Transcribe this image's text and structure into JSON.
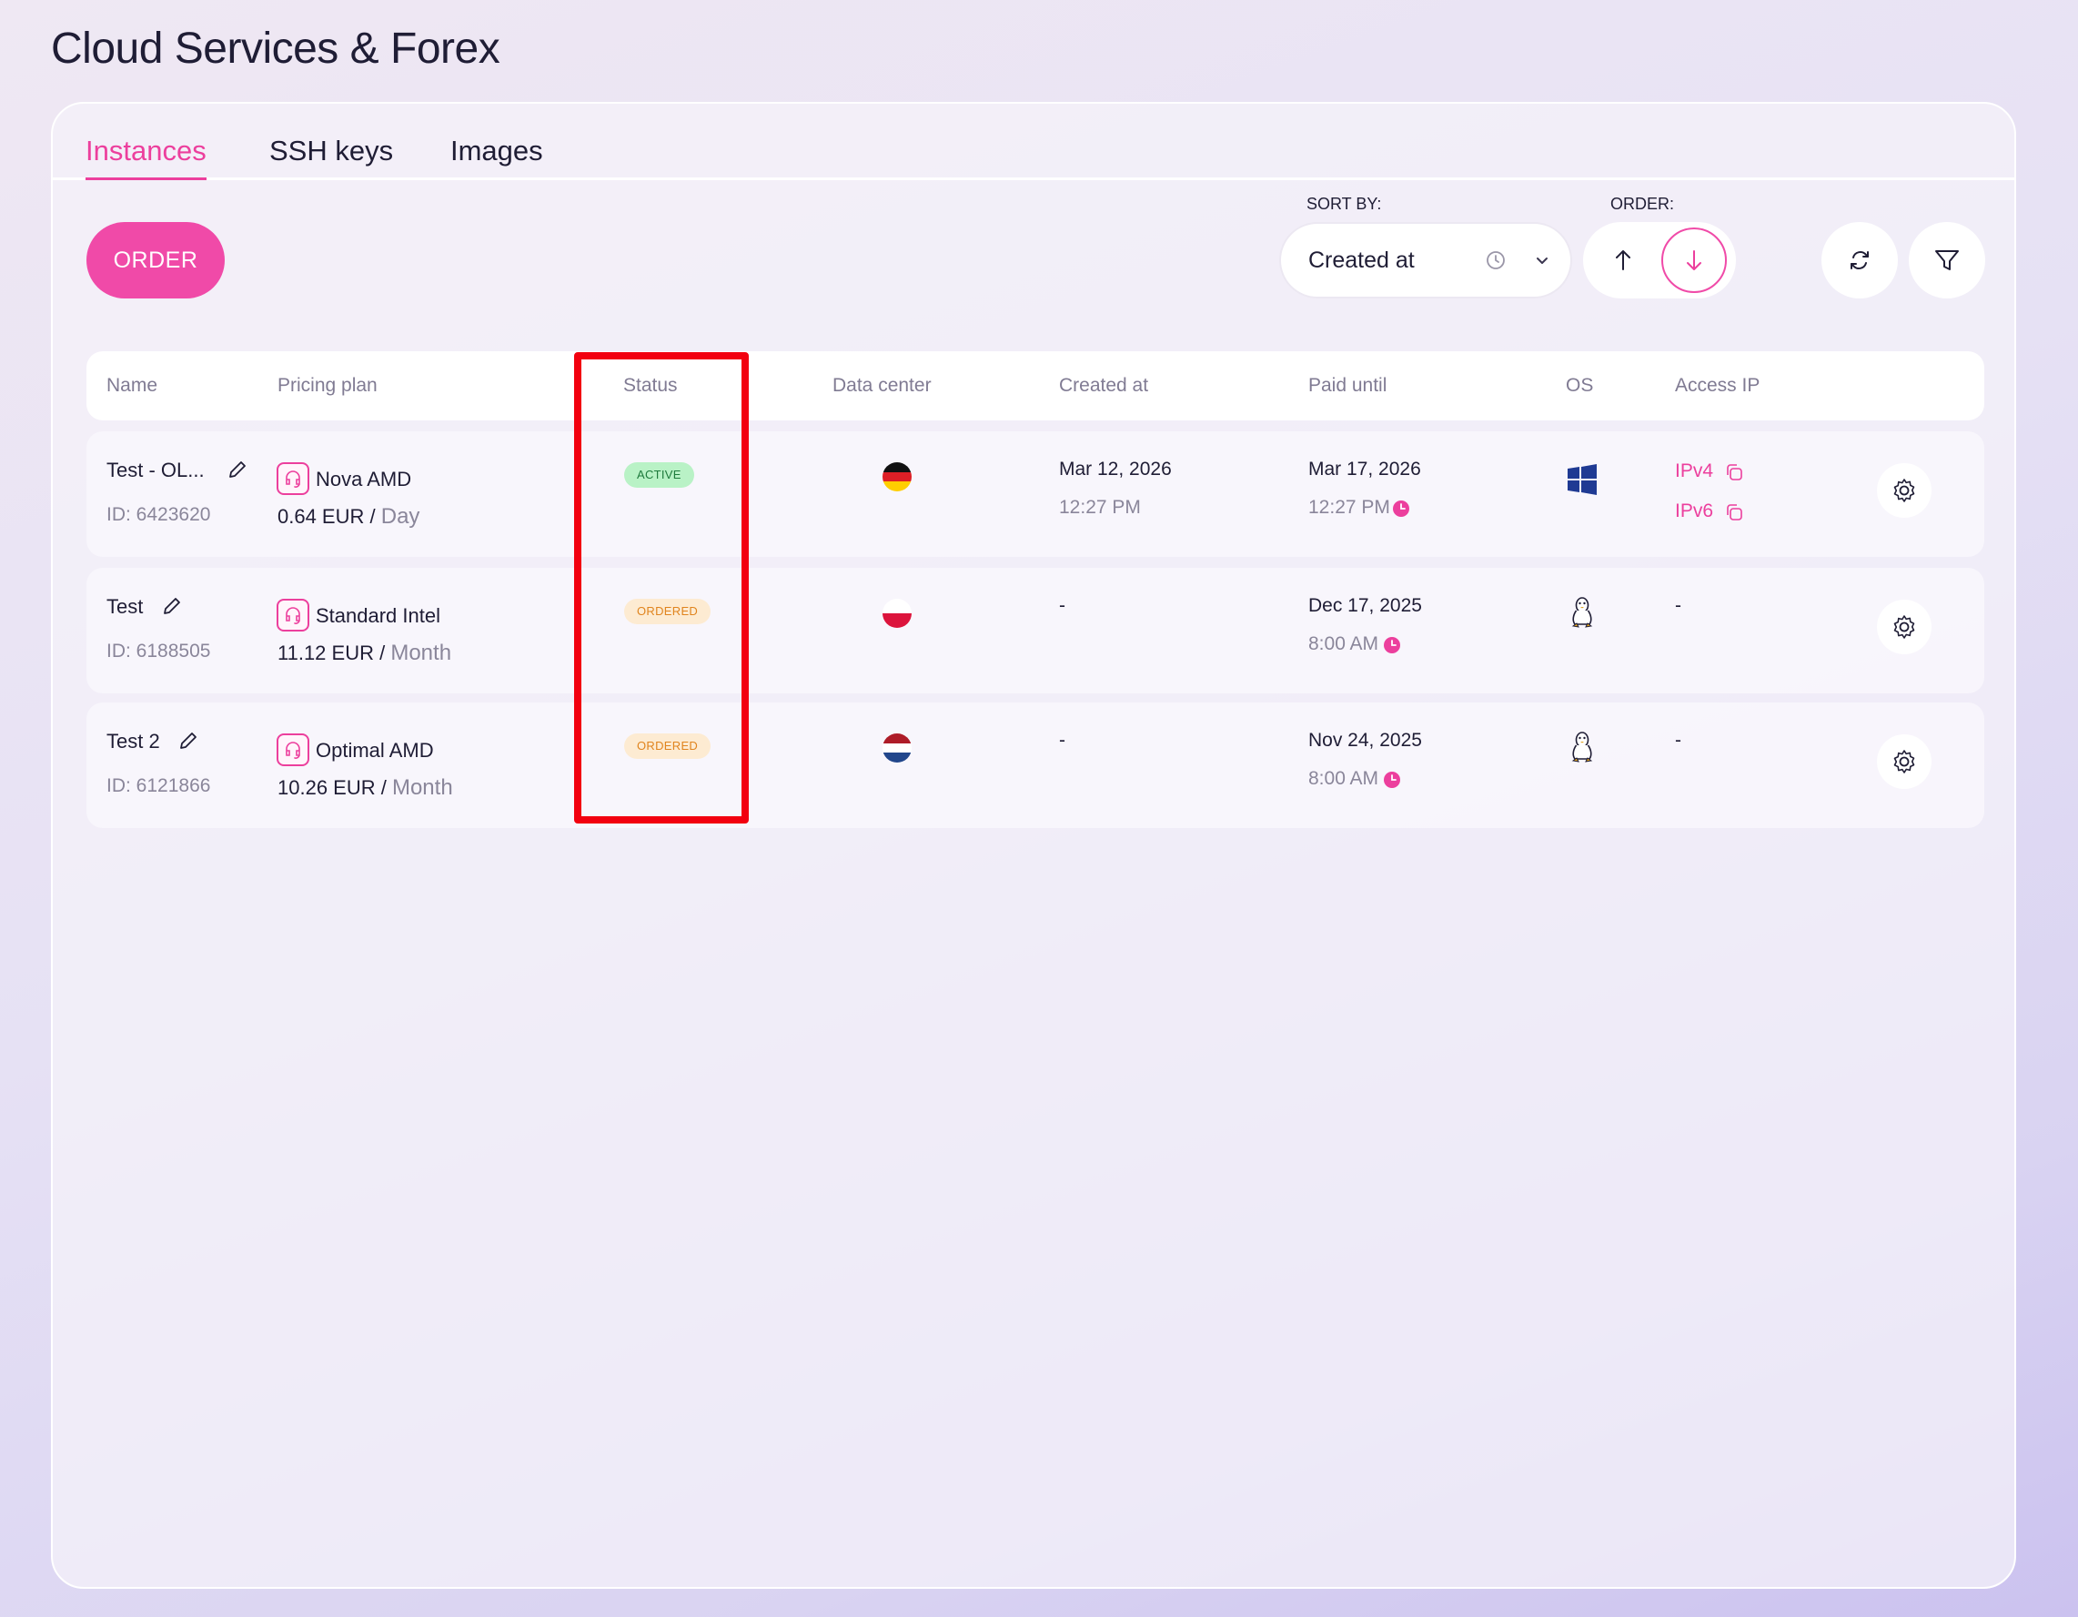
{
  "page": {
    "title": "Cloud Services & Forex"
  },
  "tabs": [
    {
      "label": "Instances",
      "active": true
    },
    {
      "label": "SSH keys",
      "active": false
    },
    {
      "label": "Images",
      "active": false
    }
  ],
  "toolbar": {
    "order_label": "ORDER",
    "sort_by_label": "SORT BY:",
    "sort_by_value": "Created at",
    "order_label_caption": "ORDER:",
    "order_direction": "descending"
  },
  "colors": {
    "accent": "#ec3f9d",
    "active_badge": "#b9f2c6",
    "ordered_badge": "#fdebd2",
    "highlight": "#f2000f"
  },
  "table": {
    "headers": [
      "Name",
      "Pricing plan",
      "Status",
      "Data center",
      "Created at",
      "Paid until",
      "OS",
      "Access IP"
    ],
    "rows": [
      {
        "name": "Test - OL...",
        "id": "ID: 6423620",
        "plan": "Nova AMD",
        "price": "0.64 EUR /",
        "period": "Day",
        "status": "ACTIVE",
        "datacenter_flag": "germany-flag",
        "created_date": "Mar 12, 2026",
        "created_time": "12:27 PM",
        "paid_date": "Mar 17, 2026",
        "paid_time": "12:27 PM",
        "os": "windows-icon",
        "ipv4": "IPv4",
        "ipv6": "IPv6"
      },
      {
        "name": "Test",
        "id": "ID: 6188505",
        "plan": "Standard Intel",
        "price": "11.12 EUR /",
        "period": "Month",
        "status": "ORDERED",
        "datacenter_flag": "poland-flag",
        "created_date": "-",
        "paid_date": "Dec 17, 2025",
        "paid_time": "8:00 AM",
        "os": "linux-icon",
        "access": "-"
      },
      {
        "name": "Test 2",
        "id": "ID: 6121866",
        "plan": "Optimal AMD",
        "price": "10.26 EUR /",
        "period": "Month",
        "status": "ORDERED",
        "datacenter_flag": "netherlands-flag",
        "created_date": "-",
        "paid_date": "Nov 24, 2025",
        "paid_time": "8:00 AM",
        "os": "linux-icon",
        "access": "-"
      }
    ]
  }
}
